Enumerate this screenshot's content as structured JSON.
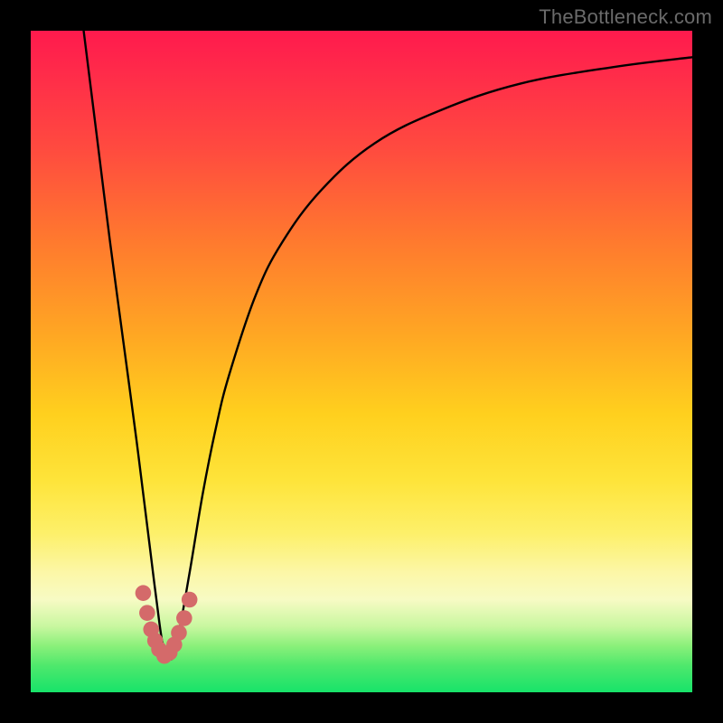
{
  "watermark": "TheBottleneck.com",
  "chart_data": {
    "type": "line",
    "title": "",
    "xlabel": "",
    "ylabel": "",
    "xlim": [
      0,
      100
    ],
    "ylim": [
      0,
      100
    ],
    "grid": false,
    "legend": false,
    "series": [
      {
        "name": "bottleneck-curve",
        "color": "#000000",
        "x": [
          8,
          10,
          12,
          14,
          16,
          18,
          19,
          20,
          21,
          22,
          24,
          26,
          28,
          30,
          34,
          38,
          44,
          52,
          62,
          74,
          88,
          100
        ],
        "values": [
          100,
          84,
          68,
          53,
          38,
          22,
          14,
          7,
          5,
          7,
          18,
          30,
          40,
          48,
          60,
          68,
          76,
          83,
          88,
          92,
          94.5,
          96
        ]
      }
    ],
    "markers": {
      "name": "trough-dots",
      "color": "#d46a6a",
      "radius_percent": 1.2,
      "x": [
        17.0,
        17.6,
        18.2,
        18.8,
        19.4,
        20.2,
        21.0,
        21.7,
        22.4,
        23.2,
        24.0
      ],
      "values": [
        15.0,
        12.0,
        9.5,
        7.8,
        6.5,
        5.5,
        6.0,
        7.2,
        9.0,
        11.2,
        14.0
      ]
    },
    "gradient_stops": [
      {
        "pct": 0,
        "color": "#ff1a4d"
      },
      {
        "pct": 18,
        "color": "#ff4b3f"
      },
      {
        "pct": 46,
        "color": "#ffa723"
      },
      {
        "pct": 68,
        "color": "#fee43a"
      },
      {
        "pct": 86,
        "color": "#f7fbc4"
      },
      {
        "pct": 100,
        "color": "#17e36a"
      }
    ]
  }
}
